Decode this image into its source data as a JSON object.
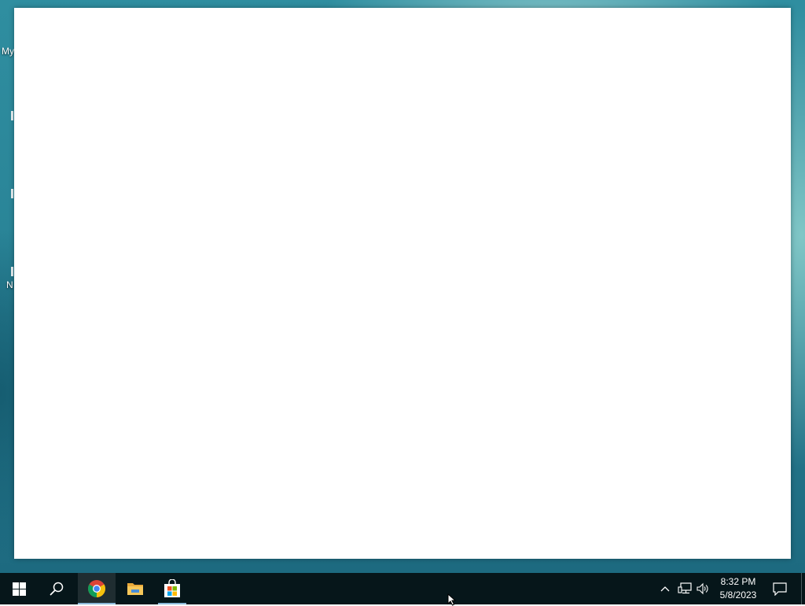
{
  "desktop": {
    "icons": [
      {
        "label": "My"
      },
      {
        "label": "N"
      }
    ]
  },
  "taskbar": {
    "start_icon": "windows-logo-icon",
    "search_icon": "search-icon",
    "pinned": [
      {
        "name": "chrome-icon",
        "active": true
      },
      {
        "name": "file-explorer-icon",
        "active": false
      },
      {
        "name": "microsoft-store-icon",
        "active": false
      }
    ],
    "tray": {
      "icons": [
        "chevron-up-icon",
        "network-icon",
        "volume-icon"
      ],
      "time": "8:32 PM",
      "date": "5/8/2023",
      "notification_icon": "action-center-icon"
    }
  },
  "colors": {
    "taskbar_bg": "#06161a",
    "accent_underline": "#8ab8d8",
    "window_bg": "#ffffff"
  }
}
